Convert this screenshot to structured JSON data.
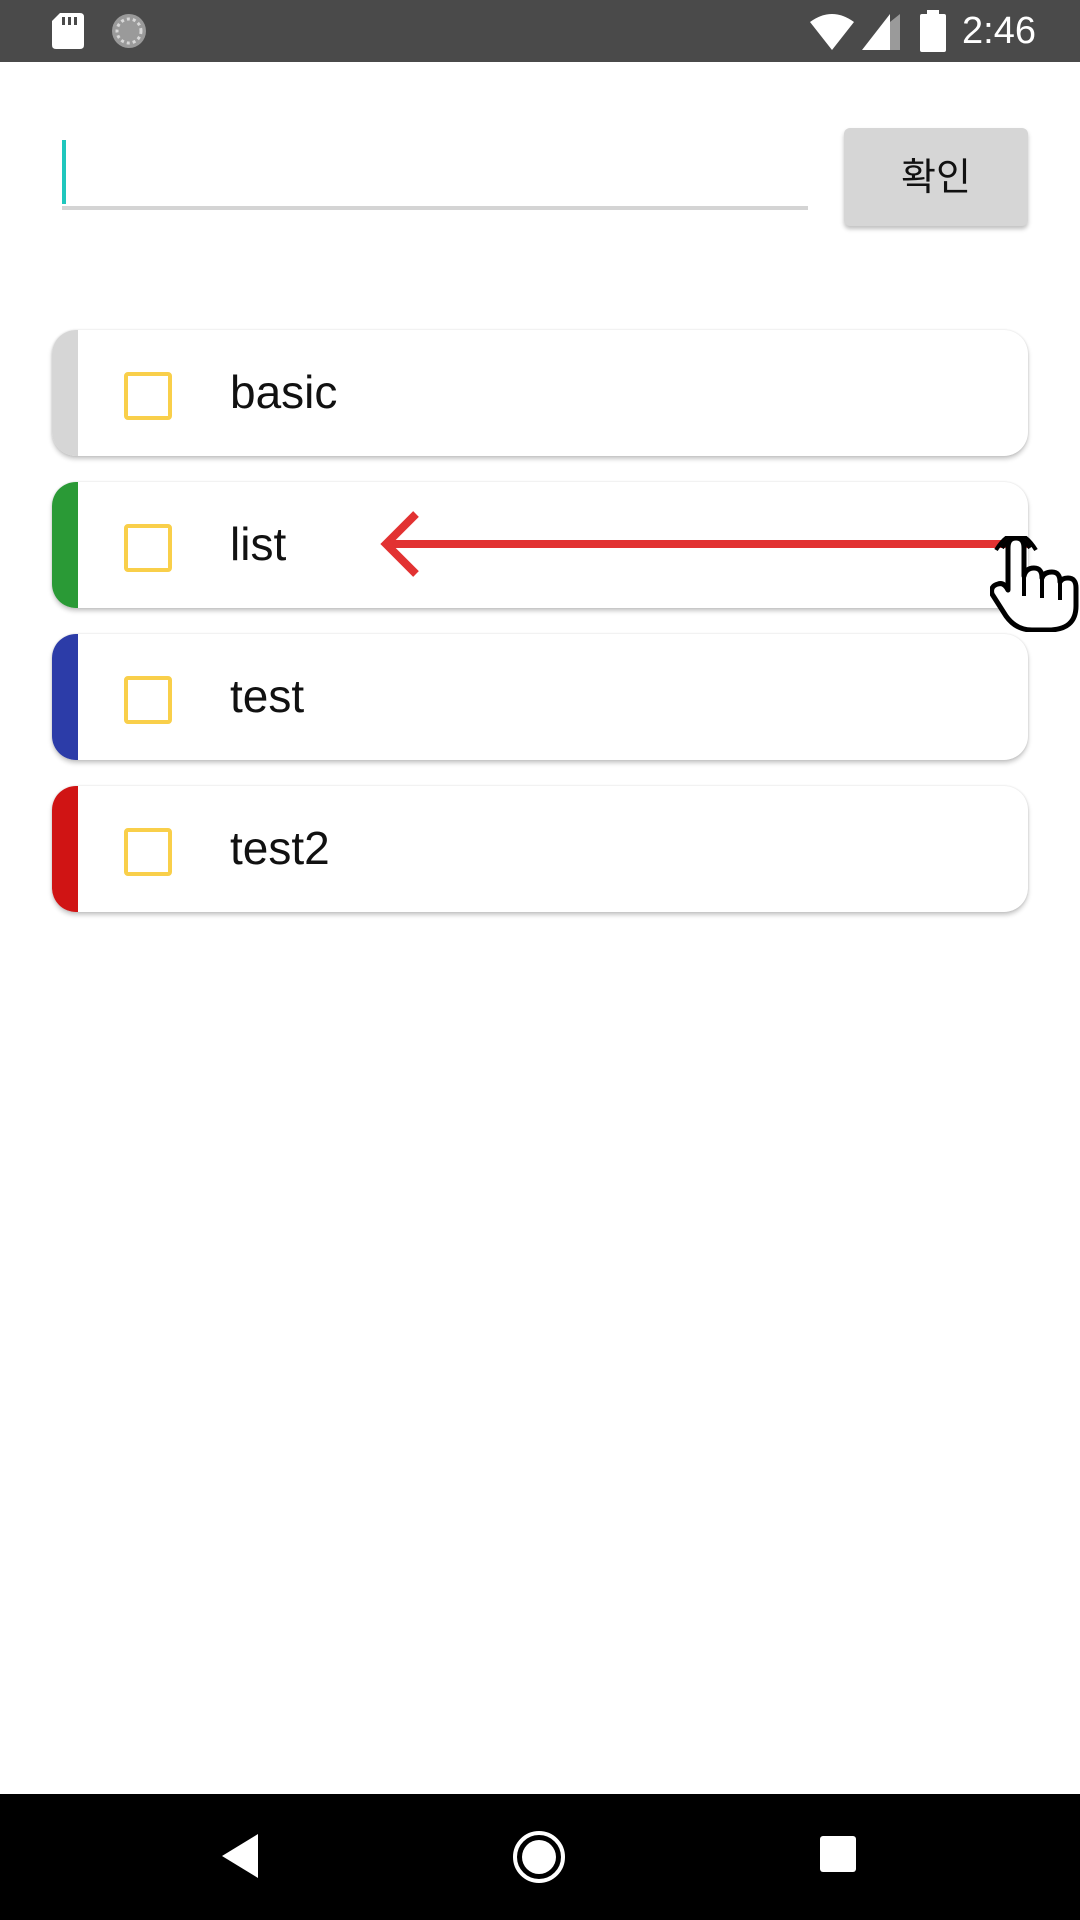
{
  "status_bar": {
    "time": "2:46",
    "icons": [
      "sd-card-icon",
      "sync-icon",
      "wifi-icon",
      "signal-icon",
      "battery-icon"
    ]
  },
  "input": {
    "value": "",
    "placeholder": ""
  },
  "confirm_button": {
    "label": "확인"
  },
  "list": {
    "items": [
      {
        "label": "basic",
        "color": "#d6d6d6",
        "checked": false
      },
      {
        "label": "list",
        "color": "#2a9a36",
        "checked": false
      },
      {
        "label": "test",
        "color": "#2c3ca8",
        "checked": false
      },
      {
        "label": "test2",
        "color": "#d01414",
        "checked": false
      }
    ]
  },
  "gesture": {
    "type": "swipe-left",
    "arrow_color": "#e23232",
    "icons": [
      "arrow-left-icon",
      "hand-pointer-icon"
    ]
  },
  "colors": {
    "accent_caret": "#1fc7bd",
    "checkbox_border": "#f9cf4a",
    "status_bar_bg": "#4a4a4a",
    "nav_bar_bg": "#000000"
  },
  "nav_bar": {
    "icons": [
      "back-icon",
      "home-icon",
      "recents-icon"
    ]
  }
}
